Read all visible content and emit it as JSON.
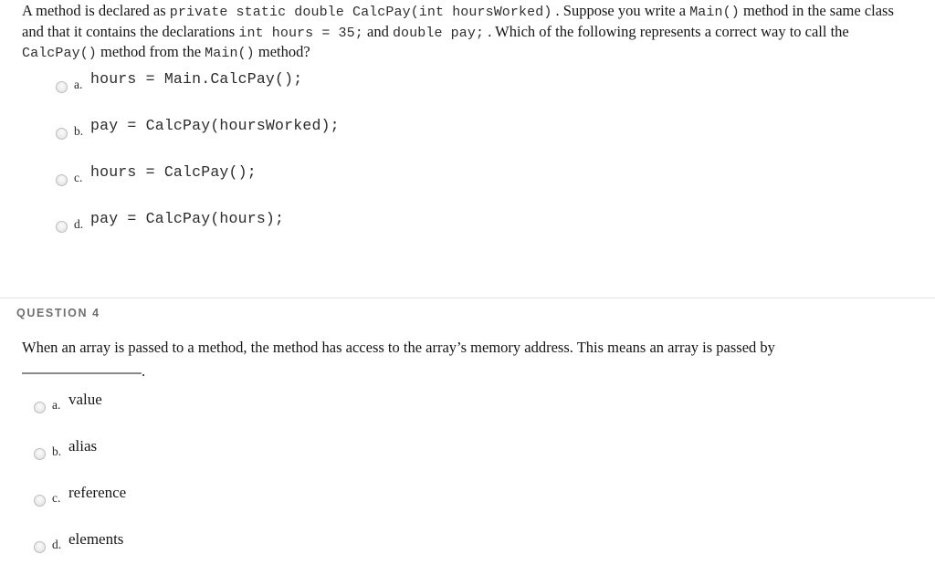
{
  "questions": [
    {
      "id": "question-3",
      "header": "",
      "stem_parts": [
        {
          "type": "text",
          "value": "A method is declared as "
        },
        {
          "type": "code",
          "value": "private static double CalcPay(int hoursWorked)"
        },
        {
          "type": "text",
          "value": " . Suppose you write a "
        },
        {
          "type": "code",
          "value": "Main()"
        },
        {
          "type": "text",
          "value": " method in the same class and that it contains the declarations "
        },
        {
          "type": "code",
          "value": "int hours = 35;"
        },
        {
          "type": "text",
          "value": " and "
        },
        {
          "type": "code",
          "value": "double pay;"
        },
        {
          "type": "text",
          "value": " . Which of the following represents a correct way to call the "
        },
        {
          "type": "code",
          "value": "CalcPay()"
        },
        {
          "type": "text",
          "value": " method from the "
        },
        {
          "type": "code",
          "value": "Main()"
        },
        {
          "type": "text",
          "value": " method?"
        }
      ],
      "answer_style": "mono",
      "answers": [
        {
          "letter": "a.",
          "text": "hours = Main.CalcPay();",
          "selected": false
        },
        {
          "letter": "b.",
          "text": "pay = CalcPay(hoursWorked);",
          "selected": false
        },
        {
          "letter": "c.",
          "text": "hours = CalcPay();",
          "selected": false
        },
        {
          "letter": "d.",
          "text": "pay = CalcPay(hours);",
          "selected": false
        }
      ]
    },
    {
      "id": "question-4",
      "header": "QUESTION 4",
      "stem_parts": [
        {
          "type": "text",
          "value": "When an array is passed to a method, the method has access to the array’s memory address. This means an array is passed by"
        }
      ],
      "blank": {
        "rule": "______________",
        "trailing": "."
      },
      "answer_style": "serif",
      "answers": [
        {
          "letter": "a.",
          "text": "value",
          "selected": false
        },
        {
          "letter": "b.",
          "text": "alias",
          "selected": false
        },
        {
          "letter": "c.",
          "text": "reference",
          "selected": false
        },
        {
          "letter": "d.",
          "text": "elements",
          "selected": false
        }
      ]
    }
  ],
  "colors": {
    "background": "#ffffff",
    "body_text": "#161616",
    "code_text": "#2e2e2e",
    "section_header": "#6f6f6f",
    "divider": "#e2e2e2",
    "radio_border": "#bdbdbd"
  }
}
